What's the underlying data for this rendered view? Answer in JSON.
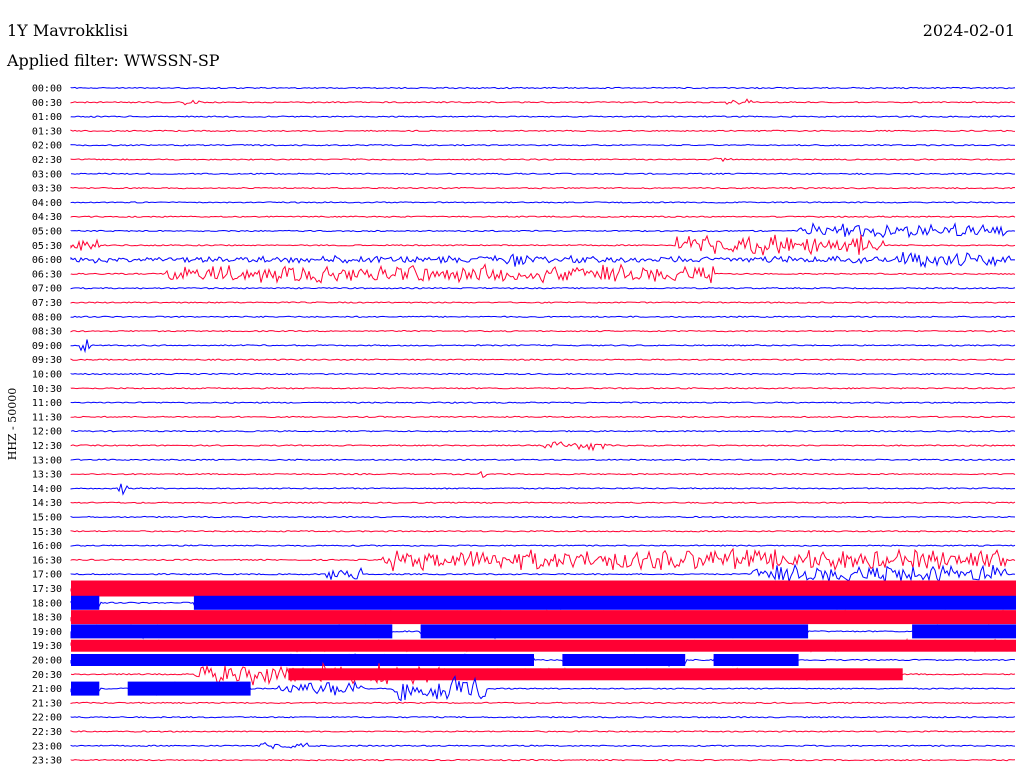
{
  "header": {
    "station": "1Y Mavrokklisi",
    "date": "2024-02-01",
    "filter": "Applied filter: WWSSN-SP"
  },
  "chart_data": {
    "type": "line",
    "title": "1Y Mavrokklisi",
    "subtitle": "Applied filter: WWSSN-SP",
    "ylabel": "HHZ - 50000",
    "xlabel": "",
    "colors": [
      "#0000ff",
      "#ff0033"
    ],
    "row_times": [
      "00:00",
      "00:30",
      "01:00",
      "01:30",
      "02:00",
      "02:30",
      "03:00",
      "03:30",
      "04:00",
      "04:30",
      "05:00",
      "05:30",
      "06:00",
      "06:30",
      "07:00",
      "07:30",
      "08:00",
      "08:30",
      "09:00",
      "09:30",
      "10:00",
      "10:30",
      "11:00",
      "11:30",
      "12:00",
      "12:30",
      "13:00",
      "13:30",
      "14:00",
      "14:30",
      "15:00",
      "15:30",
      "16:00",
      "16:30",
      "17:00",
      "17:30",
      "18:00",
      "18:30",
      "19:00",
      "19:30",
      "20:00",
      "20:30",
      "21:00",
      "21:30",
      "22:00",
      "22:30",
      "23:00",
      "23:30"
    ],
    "time_range_minutes": [
      0,
      30
    ],
    "amplitude_scale": "HHZ - 50000",
    "grid": false,
    "legend": "none"
  }
}
